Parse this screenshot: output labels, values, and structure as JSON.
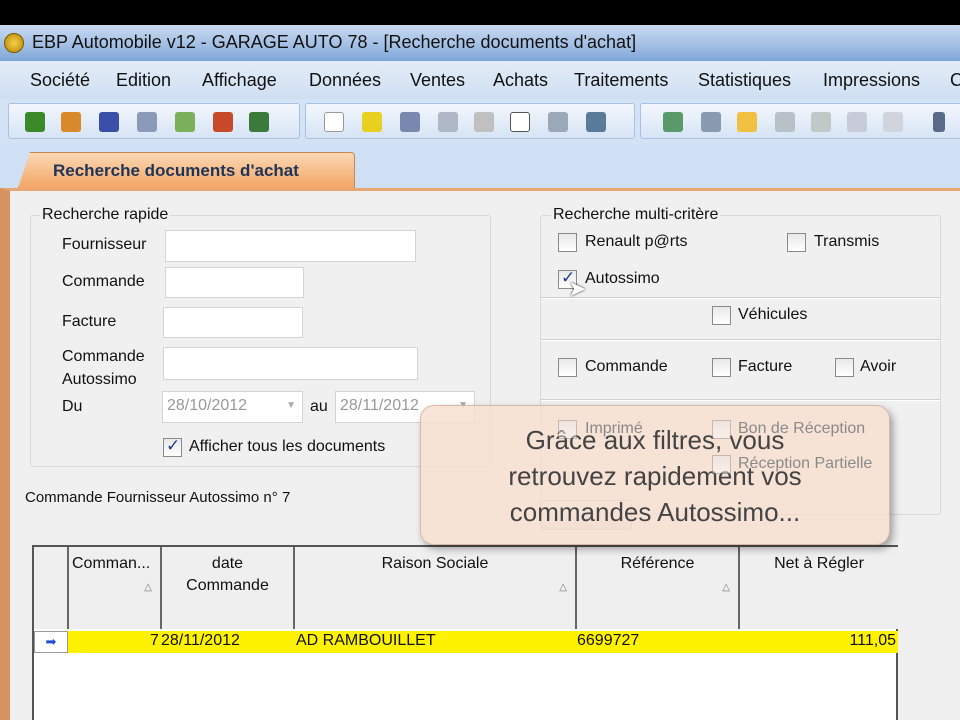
{
  "window": {
    "title": "EBP Automobile v12 - GARAGE AUTO 78 - [Recherche documents d'achat]"
  },
  "menu": [
    "Société",
    "Edition",
    "Affichage",
    "Données",
    "Ventes",
    "Achats",
    "Traitements",
    "Statistiques",
    "Impressions",
    "C"
  ],
  "toolbar": {
    "icons": [
      "client-icon",
      "vehicle-icon",
      "supplier-icon",
      "tools-icon",
      "tools-green-icon",
      "user-red-icon",
      "supplier-green-icon",
      "new-icon",
      "open-icon",
      "save-icon",
      "export-icon",
      "cut-icon",
      "copy-icon",
      "paste-icon",
      "print-icon",
      "refresh-icon",
      "list-icon",
      "envelope-icon",
      "document-icon",
      "validate-icon",
      "edit-icon",
      "edit2-icon",
      "first-icon"
    ]
  },
  "tab": {
    "label": "Recherche documents d'achat"
  },
  "quick": {
    "title": "Recherche rapide",
    "fournisseur": "Fournisseur",
    "commande": "Commande",
    "facture": "Facture",
    "cmd_auto_1": "Commande",
    "cmd_auto_2": "Autossimo",
    "du": "Du",
    "date_from": "28/10/2012",
    "au": "au",
    "date_to": "28/11/2012",
    "show_all": "Afficher tous les documents"
  },
  "multi": {
    "title": "Recherche multi-critère",
    "renault": "Renault p@rts",
    "transmis": "Transmis",
    "autossimo": "Autossimo",
    "vehicules": "Véhicules",
    "commande": "Commande",
    "facture": "Facture",
    "avoir": "Avoir",
    "imprime": "Imprimé",
    "bon_reception": "Bon de Réception",
    "reception_partielle": "Réception Partielle"
  },
  "result_label": "Commande Fournisseur Autossimo n° 7",
  "grid": {
    "headers": [
      "Comman...",
      "date Commande",
      "Raison Sociale",
      "Référence",
      "Net à Régler"
    ],
    "rows": [
      {
        "commande": "7",
        "date": "28/11/2012",
        "raison": "AD RAMBOUILLET",
        "reference": "6699727",
        "net": "111,05"
      }
    ]
  },
  "tooltip": {
    "line1": "Grâce aux filtres, vous",
    "line2": "retrouvez rapidement vos",
    "line3": "commandes Autossimo..."
  }
}
